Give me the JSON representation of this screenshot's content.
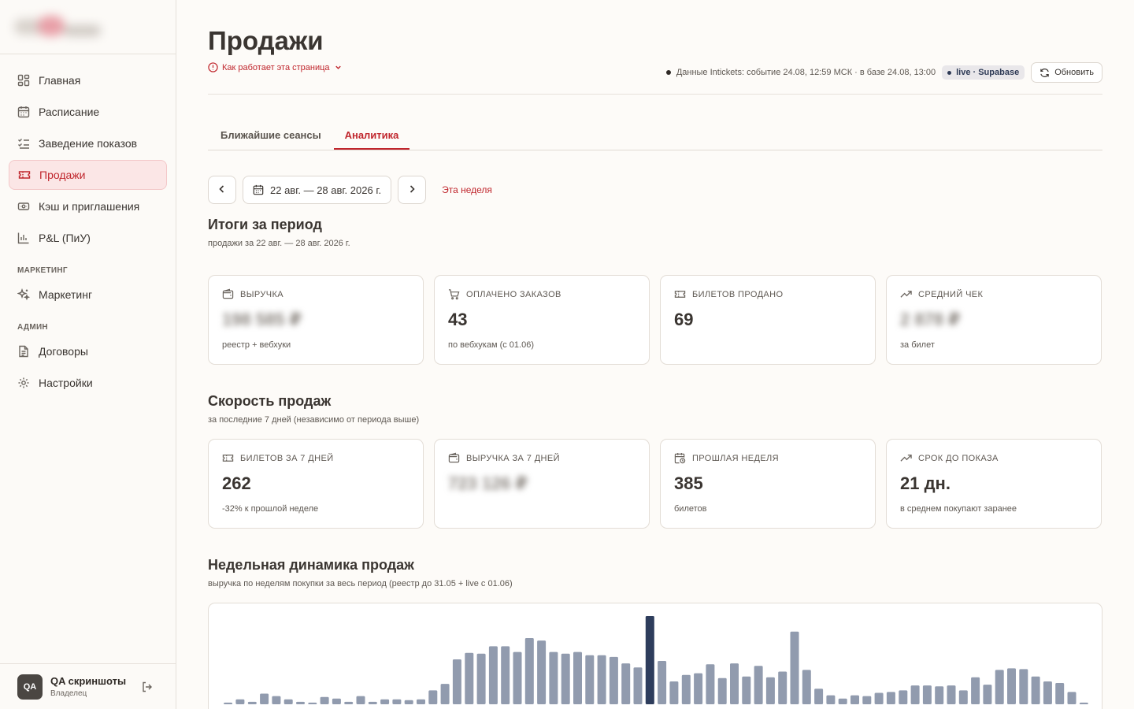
{
  "sidebar": {
    "nav": [
      {
        "label": "Главная",
        "icon": "dashboard-icon"
      },
      {
        "label": "Расписание",
        "icon": "calendar-icon"
      },
      {
        "label": "Заведение показов",
        "icon": "list-check-icon"
      },
      {
        "label": "Продажи",
        "icon": "ticket-icon",
        "active": true
      },
      {
        "label": "Кэш и приглашения",
        "icon": "banknote-icon"
      },
      {
        "label": "P&L (ПиУ)",
        "icon": "bar-chart-icon"
      }
    ],
    "marketing_section": "МАРКЕТИНГ",
    "marketing_items": [
      {
        "label": "Маркетинг",
        "icon": "sparkles-icon"
      }
    ],
    "admin_section": "АДМИН",
    "admin_items": [
      {
        "label": "Договоры",
        "icon": "document-icon"
      },
      {
        "label": "Настройки",
        "icon": "gear-icon"
      }
    ],
    "user": {
      "initials": "QA",
      "name": "QA скриншоты",
      "role": "Владелец"
    }
  },
  "header": {
    "title": "Продажи",
    "help_link": "Как работает эта страница",
    "status_text": "Данные Intickets: событие 24.08, 12:59 МСК · в базе 24.08, 13:00",
    "live_badge": "live · Supabase",
    "refresh_label": "Обновить"
  },
  "tabs": [
    {
      "label": "Ближайшие сеансы",
      "active": false
    },
    {
      "label": "Аналитика",
      "active": true
    }
  ],
  "date_range": {
    "label": "22 авг. — 28 авг. 2026 г.",
    "this_week": "Эта неделя"
  },
  "period_summary": {
    "title": "Итоги за период",
    "subtitle": "продажи за 22 авг. — 28 авг. 2026 г.",
    "cards": [
      {
        "label": "ВЫРУЧКА",
        "icon": "wallet-icon",
        "value": "198 585 ₽",
        "blurred": true,
        "note": "реестр + вебхуки"
      },
      {
        "label": "ОПЛАЧЕНО ЗАКАЗОВ",
        "icon": "cart-icon",
        "value": "43",
        "blurred": false,
        "note": "по вебхукам (с 01.06)"
      },
      {
        "label": "БИЛЕТОВ ПРОДАНО",
        "icon": "ticket-icon",
        "value": "69",
        "blurred": false,
        "note": ""
      },
      {
        "label": "СРЕДНИЙ ЧЕК",
        "icon": "trending-up-icon",
        "value": "2 878 ₽",
        "blurred": true,
        "note": "за билет"
      }
    ]
  },
  "sales_speed": {
    "title": "Скорость продаж",
    "subtitle": "за последние 7 дней (независимо от периода выше)",
    "cards": [
      {
        "label": "БИЛЕТОВ ЗА 7 ДНЕЙ",
        "icon": "ticket-icon",
        "value": "262",
        "blurred": false,
        "note": "-32% к прошлой неделе"
      },
      {
        "label": "ВЫРУЧКА ЗА 7 ДНЕЙ",
        "icon": "wallet-icon",
        "value": "723 126 ₽",
        "blurred": true,
        "note": ""
      },
      {
        "label": "ПРОШЛАЯ НЕДЕЛЯ",
        "icon": "calendar-clock-icon",
        "value": "385",
        "blurred": false,
        "note": "билетов"
      },
      {
        "label": "СРОК ДО ПОКАЗА",
        "icon": "trending-up-icon",
        "value": "21 дн.",
        "blurred": false,
        "note": "в среднем покупают заранее"
      }
    ]
  },
  "weekly": {
    "title": "Недельная динамика продаж",
    "subtitle": "выручка по неделям покупки за весь период (реестр до 31.05 + live с 01.06)"
  },
  "chart_data": {
    "type": "bar",
    "title": "",
    "xlabel": "",
    "ylabel": "",
    "values": [
      2,
      6,
      3,
      13,
      10,
      6,
      3,
      2,
      9,
      7,
      3,
      10,
      3,
      6,
      6,
      5,
      6,
      17,
      25,
      55,
      63,
      62,
      71,
      71,
      64,
      81,
      78,
      64,
      62,
      64,
      60,
      60,
      58,
      50,
      45,
      108,
      53,
      28,
      36,
      38,
      49,
      32,
      50,
      34,
      47,
      33,
      40,
      89,
      42,
      19,
      11,
      7,
      11,
      10,
      14,
      15,
      17,
      23,
      23,
      22,
      23,
      17,
      33,
      24,
      42,
      44,
      43,
      34,
      28,
      26,
      15,
      2
    ],
    "highlight_index": 35,
    "colors": {
      "bar": "#919bae",
      "highlight": "#2e3d5c"
    }
  }
}
